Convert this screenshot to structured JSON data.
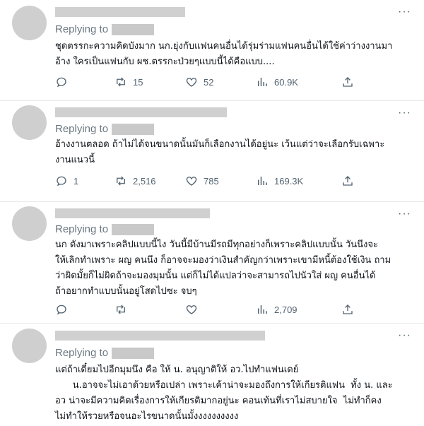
{
  "reply_prefix": "Replying to",
  "tweets": [
    {
      "text": "ชุดตรรกะความคิดบังมาก นก.ยุ่งกับแฟนคนอื่นได้รุ่มร่ามแฟนคนอื่นได้ใช้ค่าว่างงานมา\nอ้าง ใครเป็นแฟนกับ ผช.ตรรกะป่วยๆแบบนี้ได้คือแบบ....",
      "replies": "",
      "retweets": "15",
      "likes": "52",
      "views": "60.9K"
    },
    {
      "text": "อ้างงานตลอด ถ้าไม่ได้จนขนาดนั้นมันก็เลือกงานได้อยู่นะ เว้นแต่ว่าจะเลือกรับเฉพาะ\nงานแนวนี้",
      "replies": "1",
      "retweets": "2,516",
      "likes": "785",
      "views": "169.3K"
    },
    {
      "text": "นก ดังมาเพราะคลิปแบบนี้ไง วันนี้มีบ้านมีรถมีทุกอย่างก็เพราะคลิปแบบนั้น วันนึงจะ\nให้เลิกทำเพราะ ผญ คนนึง ก็อาจจะมองว่าเงินสำคัญกว่าเพราะเขามีหนี้ต้องใช้เงิน ถาม\nว่าผิดมั้ยก็ไม่ผิดถ้าจะมองมุมนั้น แต่ก็ไม่ได้แปลว่าจะสามารถไปนัวใส่ ผญ คนอื่นได้\nถ้าอยากทำแบบนั้นอยู่โสดไปซะ จบๆ",
      "replies": "",
      "retweets": "",
      "likes": "",
      "views": "2,709"
    },
    {
      "text": "แต่ถ้าเดี๋ยมไปอีกมุมนึง คือ ให้ น. อนุญาติให้ อว.ไปทำแฟนเดย์\n      น.อาจจะไม่เอาด้วยหรือเปล่า เพราะเค้าน่าจะมองถึงการให้เกียรติแฟน  ทั้ง น. และ\nอว น่าจะมีความคิดเรื่องการให้เกียรติมากอยู่นะ คอนเท้นที่เราไม่สบายใจ  ไม่ทำก็คง\nไม่ทำให้รวยหรือจนอะไรขนาดนั้นมั้งงงงงงงงงง",
      "replies": "",
      "retweets": "",
      "likes": "",
      "views": ""
    }
  ]
}
